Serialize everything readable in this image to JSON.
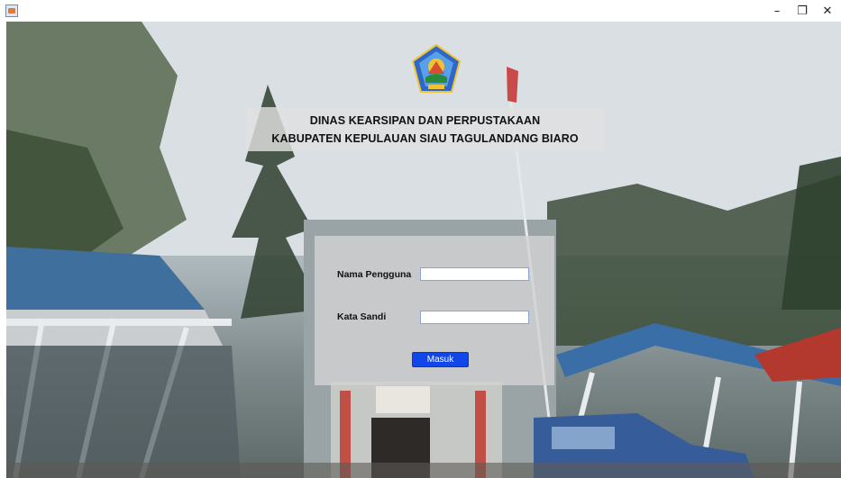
{
  "window": {
    "icon": "java-app-icon",
    "controls": {
      "minimize": "–",
      "maximize": "❐",
      "close": "✕"
    }
  },
  "header": {
    "logo": "regency-emblem-logo",
    "line1": "DINAS KEARSIPAN DAN PERPUSTAKAAN",
    "line2": "KABUPATEN KEPULAUAN SIAU TAGULANDANG BIARO"
  },
  "login": {
    "username_label": "Nama Pengguna",
    "username_value": "",
    "password_label": "Kata Sandi",
    "password_value": "",
    "submit_label": "Masuk"
  },
  "colors": {
    "button": "#1147e8",
    "field_border": "#8aa4d6"
  }
}
